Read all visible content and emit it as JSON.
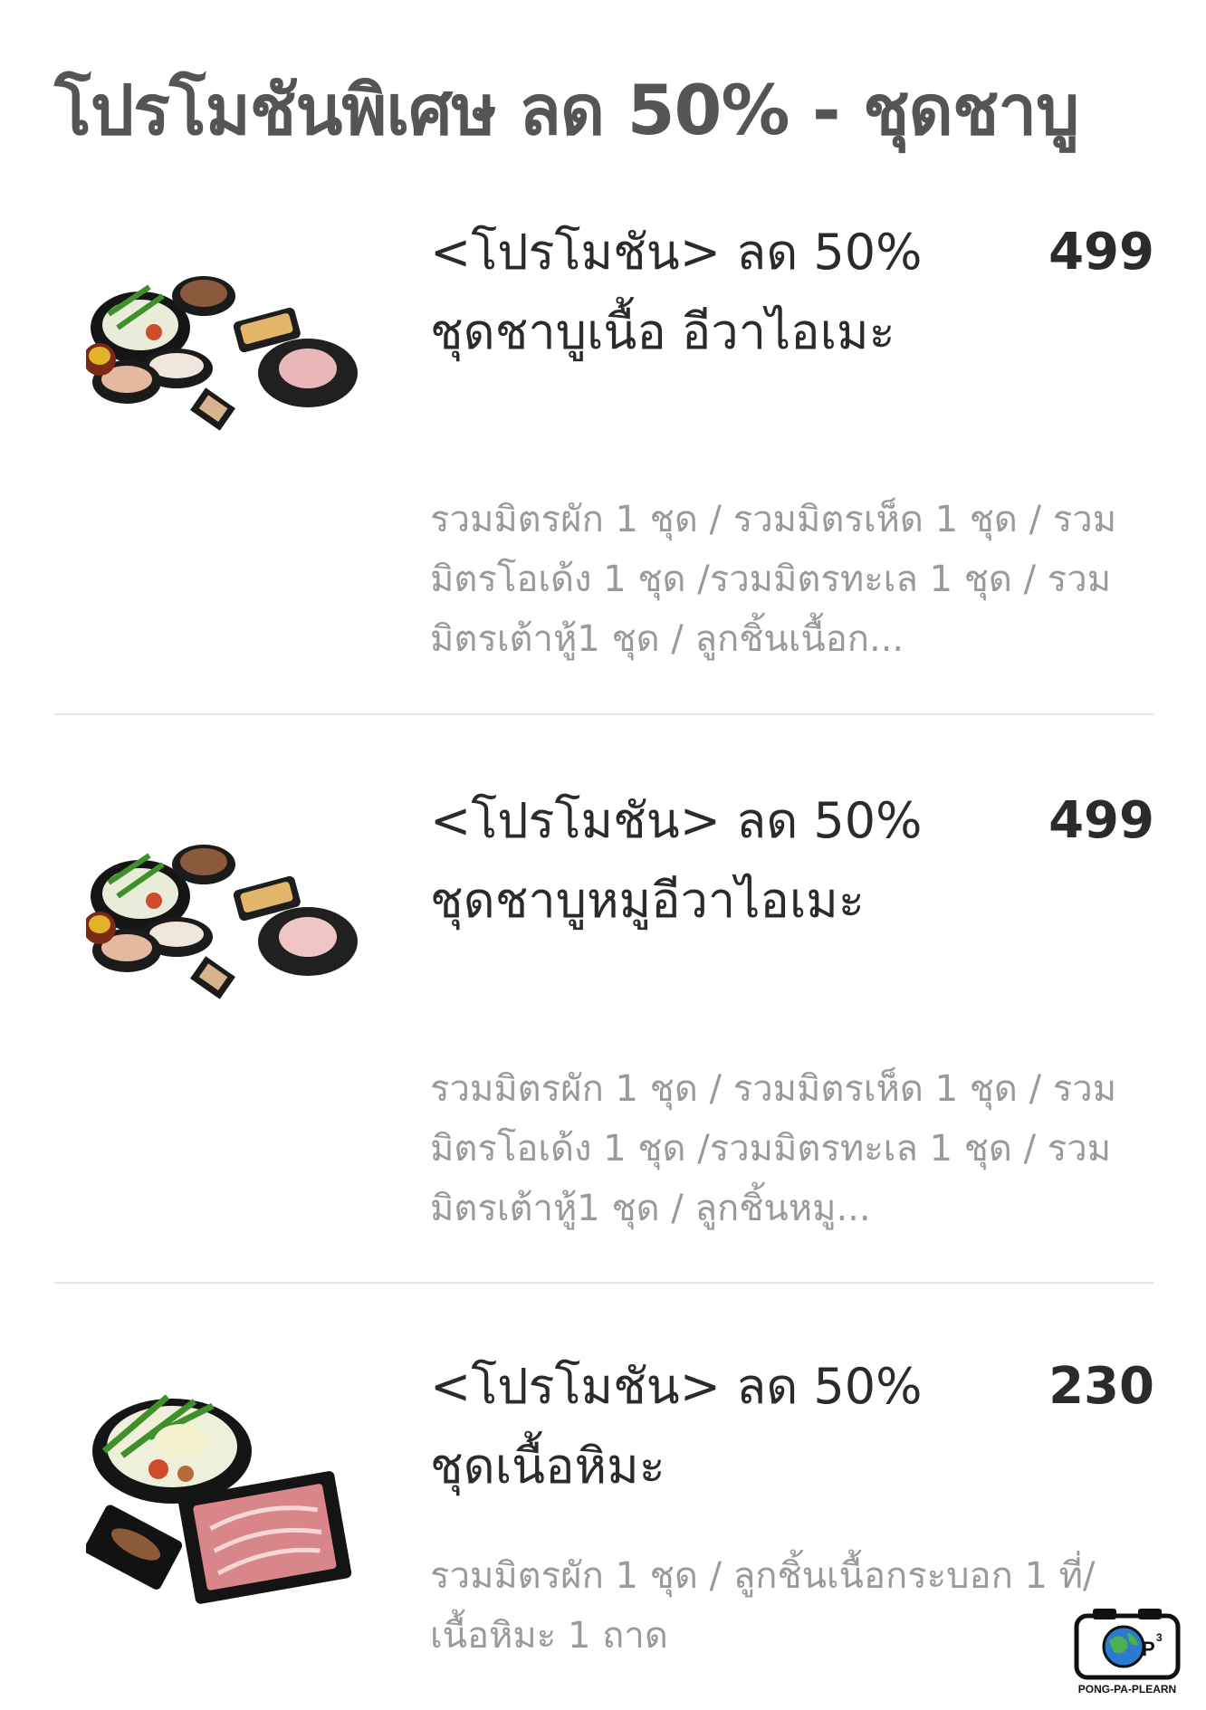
{
  "page_title": "โปรโมชันพิเศษ ลด 50% - ชุดชาบู",
  "menu_items": [
    {
      "name": "<โปรโมชัน> ลด 50% ชุดชาบูเนื้อ อีวาไอเมะ",
      "price": "499",
      "description": "รวมมิตรผัก 1 ชุด / รวมมิตรเห็ด 1 ชุด / รวมมิตรโอเด้ง 1 ชุด /รวมมิตรทะเล 1 ชุด / รวมมิตรเต้าหู้1 ชุด / ลูกชิ้นเนื้อก...",
      "image": "shabu-set-platter-image"
    },
    {
      "name": "<โปรโมชัน> ลด 50% ชุดชาบูหมูอีวาไอเมะ",
      "price": "499",
      "description": "รวมมิตรผัก 1 ชุด / รวมมิตรเห็ด 1 ชุด / รวมมิตรโอเด้ง 1 ชุด /รวมมิตรทะเล 1 ชุด / รวมมิตรเต้าหู้1 ชุด / ลูกชิ้นหมู...",
      "image": "shabu-set-platter-image"
    },
    {
      "name": "<โปรโมชัน> ลด 50% ชุดเนื้อหิมะ",
      "price": "230",
      "description": "รวมมิตรผัก 1 ชุด / ลูกชิ้นเนื้อกระบอก 1 ที่/ เนื้อหิมะ 1 ถาด",
      "image": "vegetable-and-beef-tray-image"
    }
  ],
  "watermark": {
    "text": "PONG-PA-PLEARN",
    "logo_letter": "P",
    "logo_superscript": "3"
  },
  "colors": {
    "title": "#555555",
    "item_text": "#2b2b2b",
    "description": "#9a9a9a",
    "divider": "#e6e6e6"
  }
}
